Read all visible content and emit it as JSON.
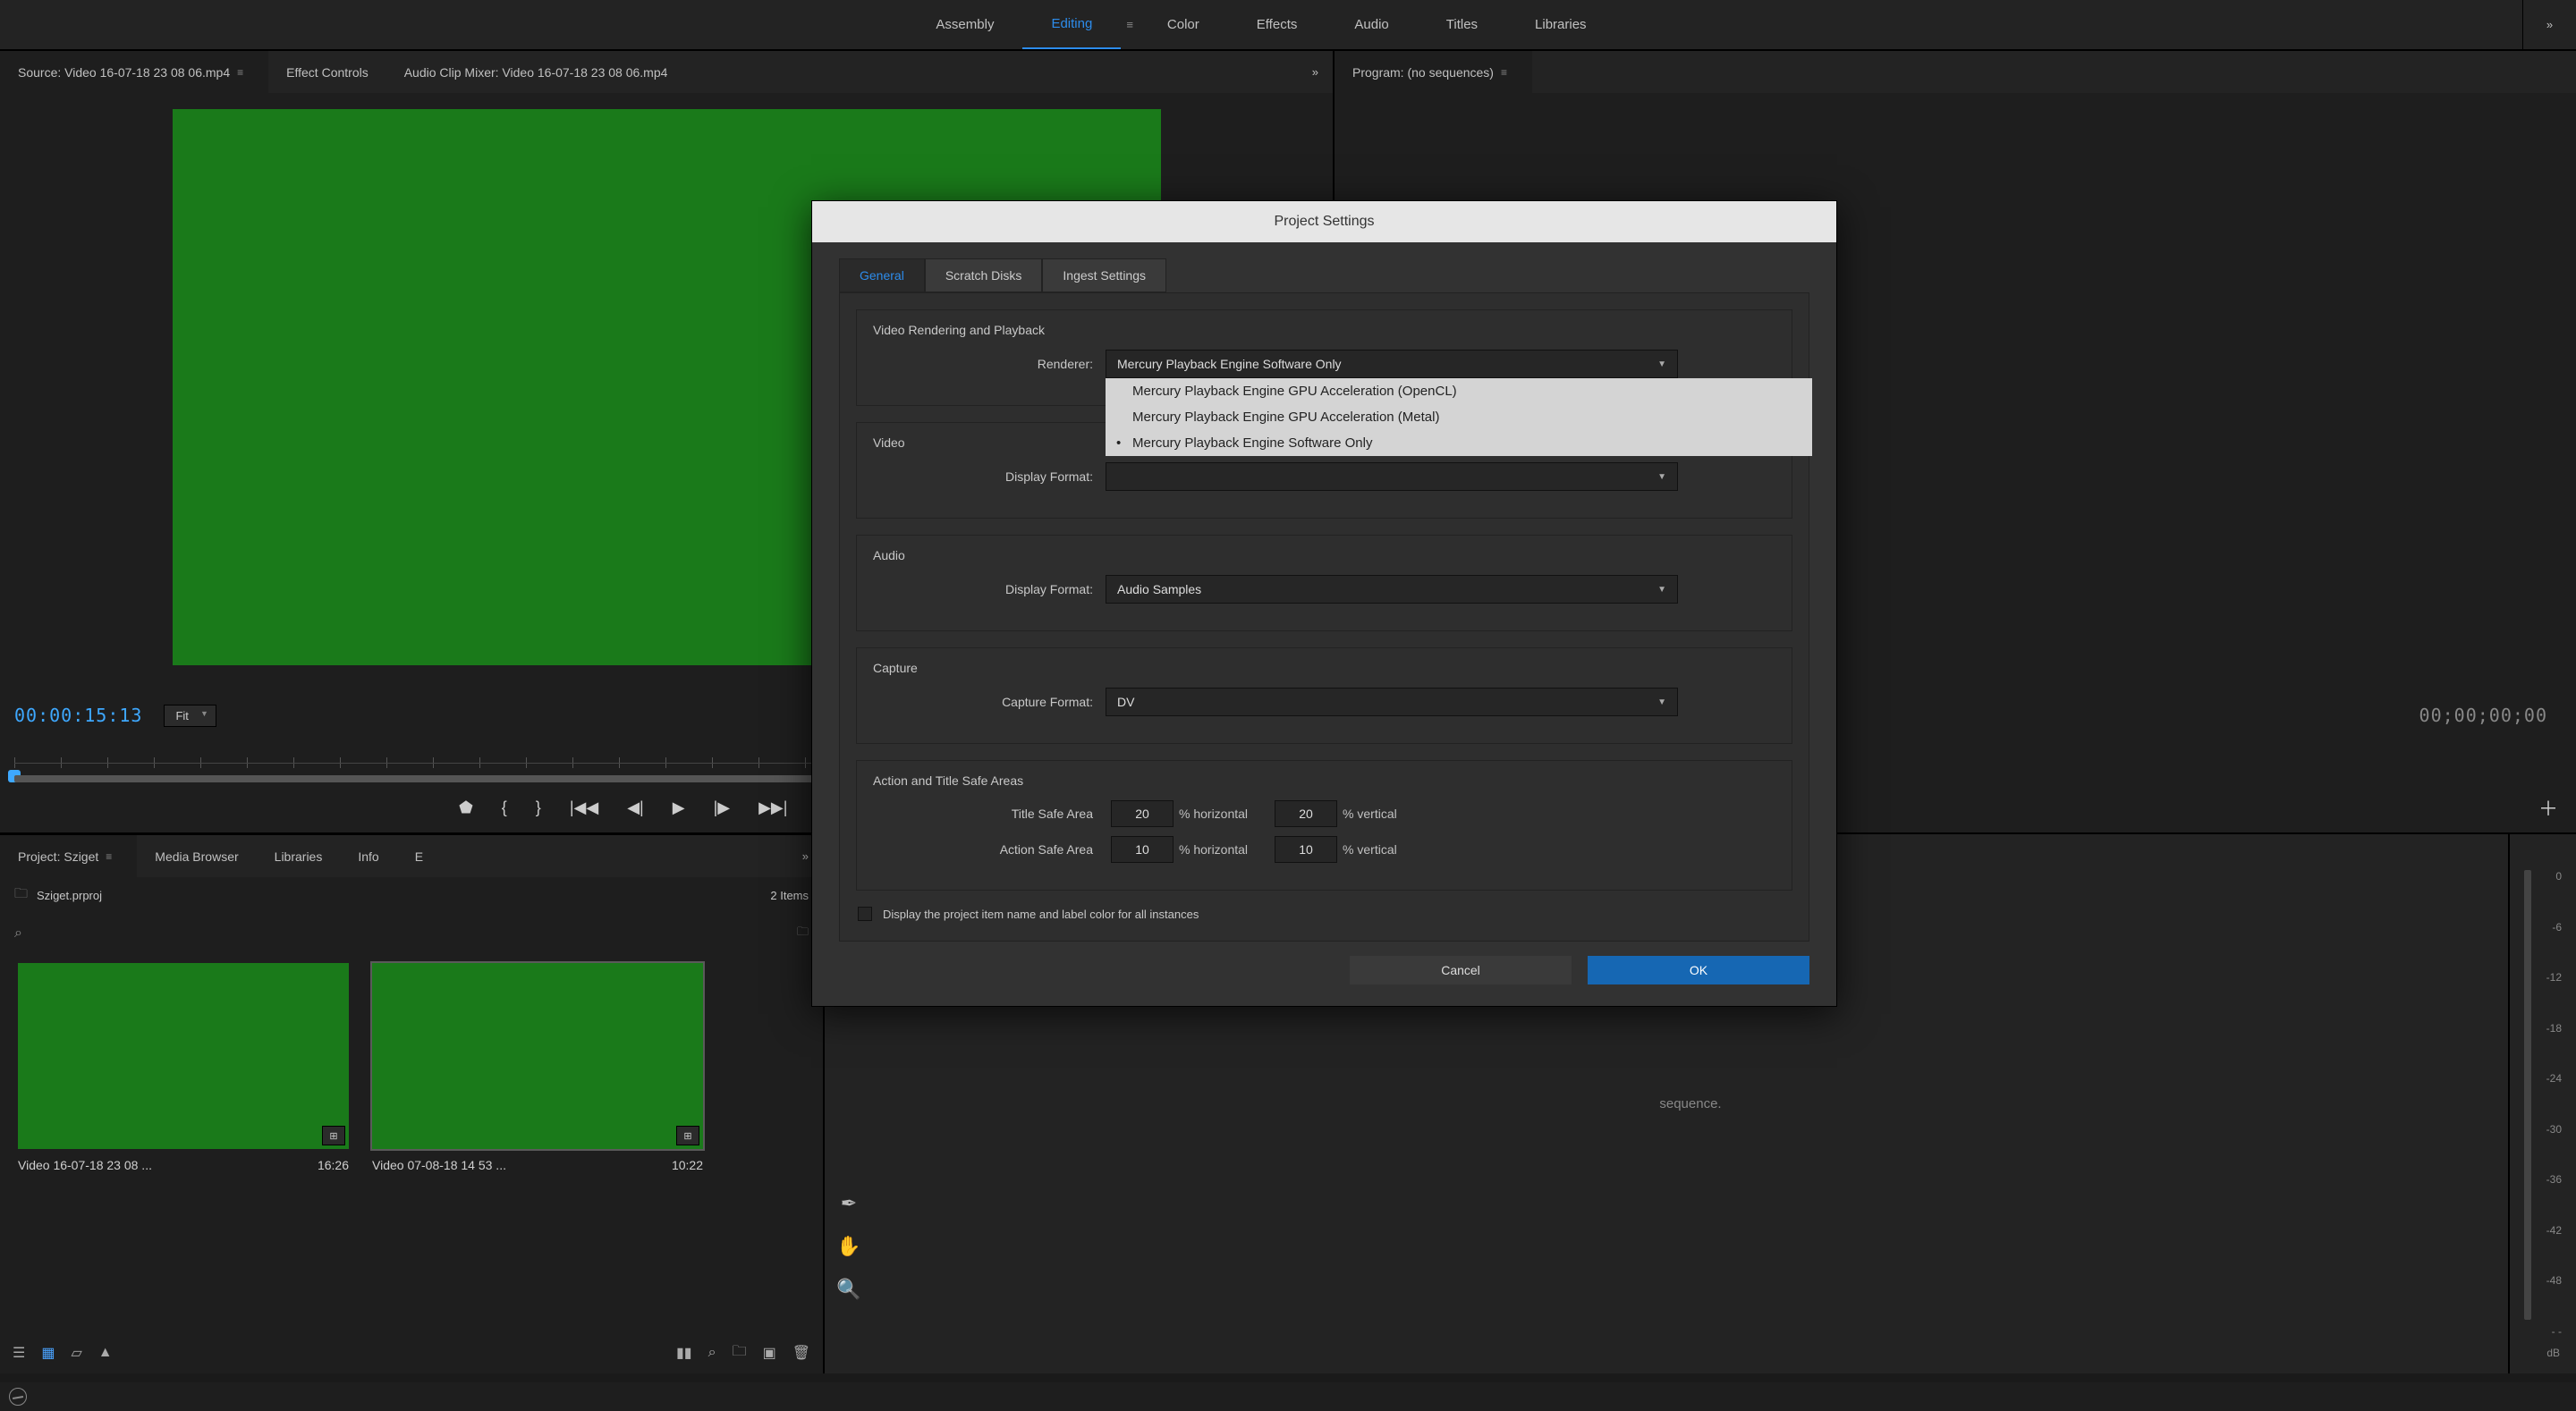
{
  "workspace": {
    "items": [
      "Assembly",
      "Editing",
      "Color",
      "Effects",
      "Audio",
      "Titles",
      "Libraries"
    ],
    "active": "Editing"
  },
  "source_tabs": {
    "items": [
      "Source: Video 16-07-18 23 08 06.mp4",
      "Effect Controls",
      "Audio Clip Mixer: Video 16-07-18 23 08 06.mp4"
    ],
    "active_index": 0
  },
  "program_tabs": {
    "title": "Program: (no sequences)"
  },
  "source": {
    "timecode": "00:00:15:13",
    "fit_label": "Fit"
  },
  "program": {
    "timecode": "00;00;00;00"
  },
  "project": {
    "tabs": [
      "Project: Sziget",
      "Media Browser",
      "Libraries",
      "Info",
      "E"
    ],
    "filename": "Sziget.prproj",
    "item_count": "2 Items",
    "clips": [
      {
        "name": "Video 16-07-18 23 08 ...",
        "dur": "16:26"
      },
      {
        "name": "Video 07-08-18 14 53 ...",
        "dur": "10:22"
      }
    ]
  },
  "timeline": {
    "hint_tail": "sequence."
  },
  "meter": {
    "ticks": [
      "0",
      "-6",
      "-12",
      "-18",
      "-24",
      "-30",
      "-36",
      "-42",
      "-48",
      "- -"
    ],
    "unit": "dB"
  },
  "modal": {
    "title": "Project Settings",
    "tabs": [
      "General",
      "Scratch Disks",
      "Ingest Settings"
    ],
    "active_tab": 0,
    "sections": {
      "render": {
        "title": "Video Rendering and Playback",
        "label": "Renderer:",
        "value": "Mercury Playback Engine Software Only"
      },
      "video": {
        "title": "Video",
        "label": "Display Format:",
        "value": ""
      },
      "audio": {
        "title": "Audio",
        "label": "Display Format:",
        "value": "Audio Samples"
      },
      "capture": {
        "title": "Capture",
        "label": "Capture Format:",
        "value": "DV"
      },
      "safe": {
        "title": "Action and Title Safe Areas",
        "title_safe_label": "Title Safe Area",
        "action_safe_label": "Action Safe Area",
        "title_h": "20",
        "title_v": "20",
        "action_h": "10",
        "action_v": "10",
        "horiz": "% horizontal",
        "vert": "% vertical"
      }
    },
    "checkbox_label": "Display the project item name and label color for all instances",
    "renderer_options": [
      "Mercury Playback Engine GPU Acceleration (OpenCL)",
      "Mercury Playback Engine GPU Acceleration (Metal)",
      "Mercury Playback Engine Software Only"
    ],
    "renderer_selected": 2,
    "buttons": {
      "cancel": "Cancel",
      "ok": "OK"
    }
  }
}
